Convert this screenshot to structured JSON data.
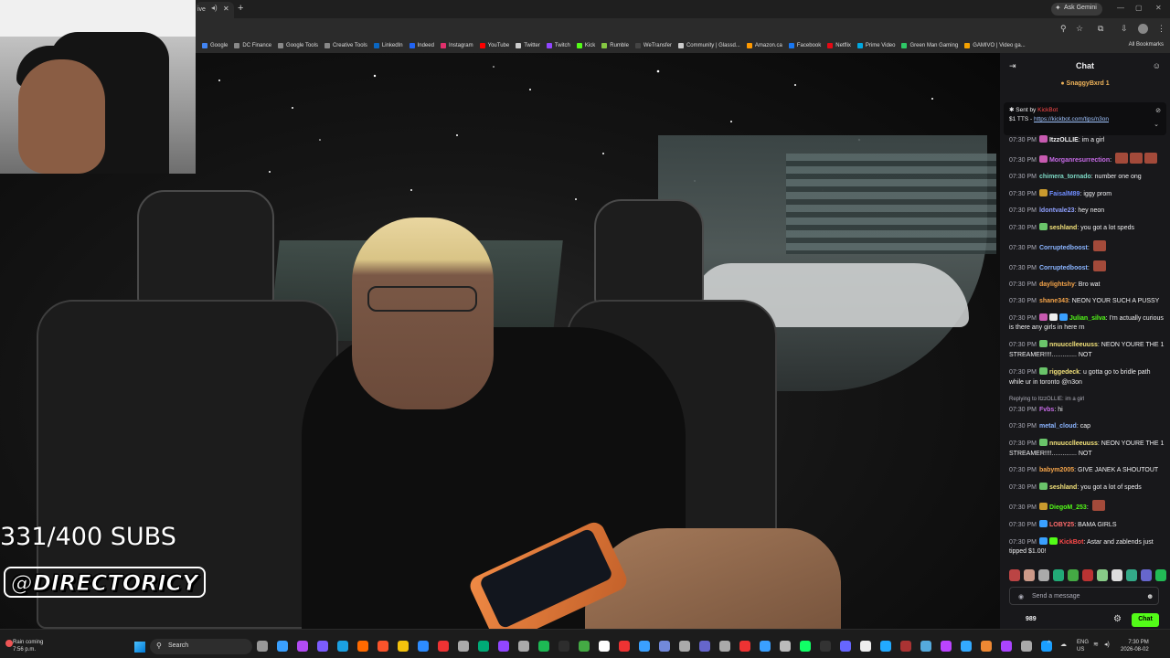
{
  "browser": {
    "ask_gemini": "Ask Gemini",
    "bookmarks": [
      {
        "label": "Google",
        "color": "#4285f4"
      },
      {
        "label": "DC Finance",
        "color": "#888888"
      },
      {
        "label": "Google Tools",
        "color": "#888888"
      },
      {
        "label": "Creative Tools",
        "color": "#888888"
      },
      {
        "label": "LinkedIn",
        "color": "#0a66c2"
      },
      {
        "label": "Indeed",
        "color": "#2164f3"
      },
      {
        "label": "Instagram",
        "color": "#e1306c"
      },
      {
        "label": "YouTube",
        "color": "#ff0000"
      },
      {
        "label": "Twitter",
        "color": "#cccccc"
      },
      {
        "label": "Twitch",
        "color": "#9146ff"
      },
      {
        "label": "Kick",
        "color": "#53fc18"
      },
      {
        "label": "Rumble",
        "color": "#85c742"
      },
      {
        "label": "WeTransfer",
        "color": "#444444"
      },
      {
        "label": "Community | Glassd...",
        "color": "#cccccc"
      },
      {
        "label": "Amazon.ca",
        "color": "#ff9900"
      },
      {
        "label": "Facebook",
        "color": "#1877f2"
      },
      {
        "label": "Netflix",
        "color": "#e50914"
      },
      {
        "label": "Prime Video",
        "color": "#00a8e1"
      },
      {
        "label": "Green Man Gaming",
        "color": "#2ec866"
      },
      {
        "label": "GAMIVO | Video ga...",
        "color": "#f4a100"
      }
    ],
    "all_bookmarks": "All Bookmarks"
  },
  "stream": {
    "sub_goal": "331/400 SUBS",
    "handle": "@DIRECTORICY"
  },
  "chat": {
    "title": "Chat",
    "gift_line": "SnaggyBxrd 1",
    "pinned": {
      "sent_by": "Sent by",
      "bot": "KickBot",
      "text_prefix": "$1 TTS - ",
      "link": "https://kickbot.com/tips/n3on"
    },
    "messages": [
      {
        "time": "07:30 PM",
        "user": "ItzzOLLIE",
        "color": "#efeff1",
        "text": "im a girl",
        "badges": [
          "#c75ab0"
        ]
      },
      {
        "time": "07:30 PM",
        "user": "Morganresurrection",
        "color": "#c86be8",
        "text": "",
        "badges": [
          "#c75ab0"
        ],
        "emotes": 3
      },
      {
        "time": "07:30 PM",
        "user": "chimera_tornado",
        "color": "#7dd9c5",
        "text": "number one ong",
        "badges": []
      },
      {
        "time": "07:30 PM",
        "user": "FaisalM89",
        "color": "#6f8dff",
        "text": "iggy prom",
        "badges": [
          "#c99a2e"
        ]
      },
      {
        "time": "07:30 PM",
        "user": "ldontvale23",
        "color": "#8fa0ff",
        "text": "hey neon",
        "badges": []
      },
      {
        "time": "07:30 PM",
        "user": "seshland",
        "color": "#f3e27a",
        "text": "you got a lot speds",
        "badges": [
          "#6ac46a"
        ]
      },
      {
        "time": "07:30 PM",
        "user": "Corruptedboost",
        "color": "#8ab4ff",
        "text": "",
        "badges": [],
        "emotes": 1
      },
      {
        "time": "07:30 PM",
        "user": "Corruptedboost",
        "color": "#8ab4ff",
        "text": "",
        "badges": [],
        "emotes": 1
      },
      {
        "time": "07:30 PM",
        "user": "daylightshy",
        "color": "#f6a54a",
        "text": "Bro wat",
        "badges": []
      },
      {
        "time": "07:30 PM",
        "user": "shane343",
        "color": "#f6a54a",
        "text": "NEON YOUR SUCH A PUSSY",
        "badges": []
      },
      {
        "time": "07:30 PM",
        "user": "Julian_silva",
        "color": "#53fc18",
        "text": "I'm actually curious is there any girls in here rn",
        "badges": [
          "#c75ab0",
          "#eeeeee",
          "#3aa0ff"
        ]
      },
      {
        "time": "07:30 PM",
        "user": "nnuucclleeuuss",
        "color": "#f3e27a",
        "text": "NEON YOURE THE 1 STREAMER!!!!.............. NOT",
        "badges": [
          "#6ac46a"
        ]
      },
      {
        "time": "07:30 PM",
        "user": "riggedeck",
        "color": "#f3e27a",
        "text": "u gotta go to bridle path while ur in toronto @n3on",
        "badges": [
          "#6ac46a"
        ]
      },
      {
        "time": "07:30 PM",
        "user": "Fvbs",
        "color": "#c86be8",
        "text": "hi",
        "badges": [],
        "reply": "Replying to ItzzOLLIE: im a girl"
      },
      {
        "time": "07:30 PM",
        "user": "metal_cloud",
        "color": "#8ab4ff",
        "text": "cap",
        "badges": []
      },
      {
        "time": "07:30 PM",
        "user": "nnuucclleeuuss",
        "color": "#f3e27a",
        "text": "NEON YOURE THE 1 STREAMER!!!!.............. NOT",
        "badges": [
          "#6ac46a"
        ]
      },
      {
        "time": "07:30 PM",
        "user": "babym2005",
        "color": "#f6a54a",
        "text": "GIVE JANEK A SHOUTOUT",
        "badges": []
      },
      {
        "time": "07:30 PM",
        "user": "seshland",
        "color": "#f3e27a",
        "text": "you got a lot of speds",
        "badges": [
          "#6ac46a"
        ]
      },
      {
        "time": "07:30 PM",
        "user": "DiegoM_253",
        "color": "#53fc18",
        "text": "",
        "badges": [
          "#c99a2e"
        ],
        "emotes": 1
      },
      {
        "time": "07:30 PM",
        "user": "LOBY25",
        "color": "#ff6b6b",
        "text": "BAMA GIRLS",
        "badges": [
          "#3aa0ff"
        ]
      },
      {
        "time": "07:30 PM",
        "user": "KickBot",
        "color": "#ff4a4a",
        "text": "Astar and zablends just tipped $1.00!",
        "badges": [
          "#3aa0ff",
          "#53fc18"
        ]
      }
    ],
    "input_placeholder": "Send a message",
    "viewer_count": "989",
    "send_label": "Chat"
  },
  "taskbar": {
    "weather_line1": "Rain coming",
    "weather_line2": "7:56 p.m.",
    "search": "Search",
    "lang_line1": "ENG",
    "lang_line2": "US",
    "time": "7:30 PM",
    "date": "2026-08-02"
  }
}
